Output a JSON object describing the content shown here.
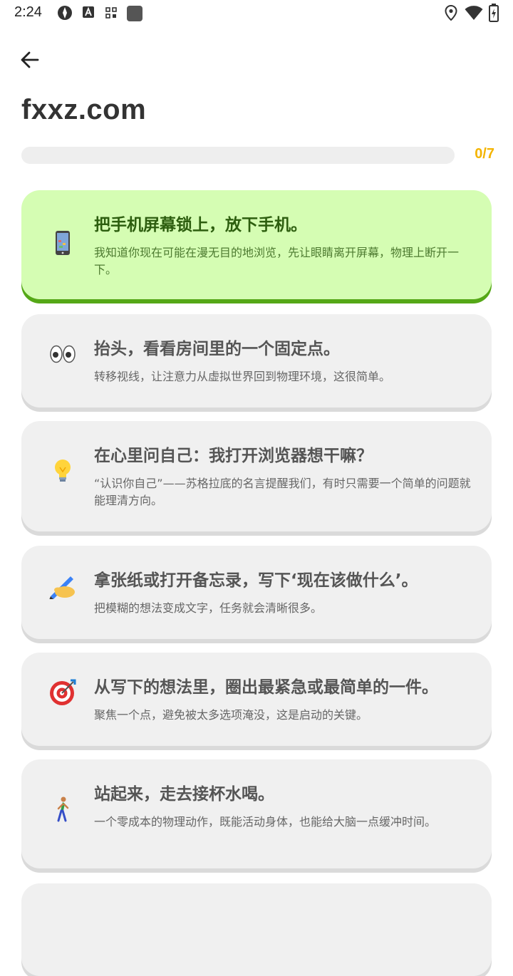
{
  "status_bar": {
    "time": "2:24"
  },
  "header": {
    "title": "fxxz.com"
  },
  "progress": {
    "completed": 0,
    "total": 7,
    "label": "0/7"
  },
  "tasks": [
    {
      "icon": "phone-icon",
      "title": "把手机屏幕锁上，放下手机。",
      "desc": "我知道你现在可能在漫无目的地浏览，先让眼睛离开屏幕，物理上断开一下。"
    },
    {
      "icon": "eyes-icon",
      "title": "抬头，看看房间里的一个固定点。",
      "desc": "转移视线，让注意力从虚拟世界回到物理环境，这很简单。"
    },
    {
      "icon": "lightbulb-icon",
      "title": "在心里问自己：我打开浏览器想干嘛？",
      "desc": "“认识你自己”——苏格拉底的名言提醒我们，有时只需要一个简单的问题就能理清方向。"
    },
    {
      "icon": "writing-hand-icon",
      "title": "拿张纸或打开备忘录，写下‘现在该做什么’。",
      "desc": "把模糊的想法变成文字，任务就会清晰很多。"
    },
    {
      "icon": "target-icon",
      "title": "从写下的想法里，圈出最紧急或最简单的一件。",
      "desc": "聚焦一个点，避免被太多选项淹没，这是启动的关键。"
    },
    {
      "icon": "walking-person-icon",
      "title": "站起来，走去接杯水喝。",
      "desc": "一个零成本的物理动作，既能活动身体，也能给大脑一点缓冲时间。"
    }
  ],
  "colors": {
    "accent": "#f4b400",
    "active_card": "#d5fdb3",
    "active_border": "#55a817",
    "card": "#f0f0f0"
  }
}
